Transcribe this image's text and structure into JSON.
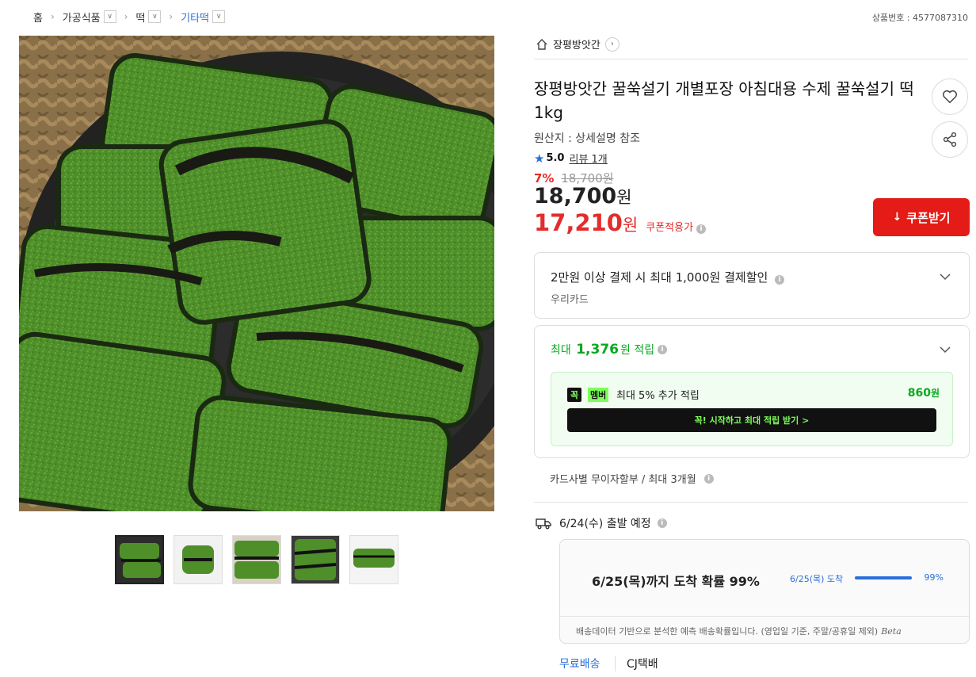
{
  "breadcrumb": {
    "items": [
      "홈",
      "가공식품",
      "떡",
      "기타떡"
    ],
    "product_no": "상품번호 : 4577087310"
  },
  "seller": {
    "name": "장평방앗간"
  },
  "product": {
    "title": "장평방앗간 꿀쑥설기 개별포장 아침대용 수제 꿀쑥설기 떡 1kg",
    "origin": "원산지 : 상세설명 참조",
    "rating": "5.0",
    "reviews": "리뷰 1개",
    "discount_rate": "7%",
    "original_price": "18,700원",
    "price": "18,700",
    "price_unit": "원",
    "coupon_price": "17,210",
    "coupon_unit": "원",
    "coupon_tag": "쿠폰적용가"
  },
  "buttons": {
    "coupon": "쿠폰받기"
  },
  "payment_benefit": {
    "title": "2만원 이상 결제 시 최대 1,000원 결제할인",
    "card": "우리카드"
  },
  "points": {
    "prefix": "최대",
    "amount": "1,376",
    "suffix": "원 적립",
    "member_badge_k": "꼭",
    "member_badge_m": "멤버",
    "member_text": "최대 5% 추가 적립",
    "member_points": "860",
    "member_unit": "원",
    "cta": "꼭! 시작하고 최대 적립 받기  >"
  },
  "installment": "카드사별 무이자할부 / 최대 3개월",
  "shipping": {
    "departure": "6/24(수) 출발 예정",
    "arrival_main": "6/25(목)까지 도착 확률 99%",
    "arrival_date": "6/25(목) 도착",
    "arrival_pct": "99%",
    "arrival_progress": 0.99,
    "note": "배송데이터 기반으로 분석한 예측 배송확률입니다. (영업일 기준, 주말/공휴일 제외)",
    "beta": "Beta",
    "free": "무료배송",
    "carrier": "CJ택배"
  },
  "colors": {
    "accent_red": "#e41b16",
    "accent_blue": "#2a6fdb",
    "accent_green": "#0aa81f"
  }
}
